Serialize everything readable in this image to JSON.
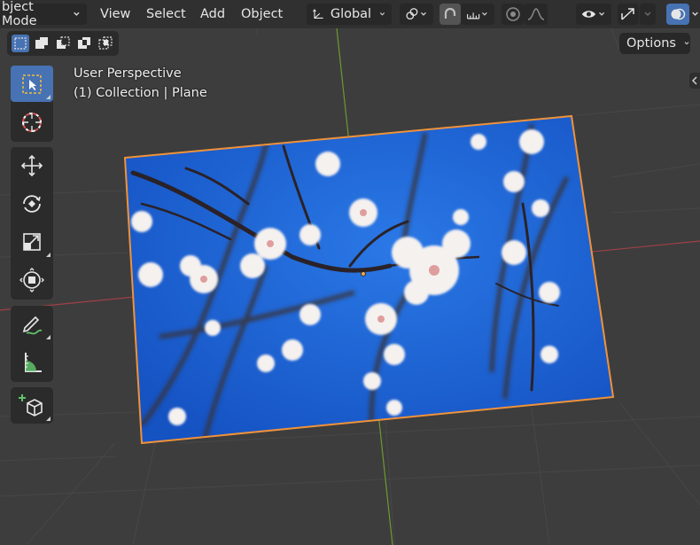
{
  "header": {
    "mode_label": "bject Mode",
    "menus": [
      "View",
      "Select",
      "Add",
      "Object"
    ],
    "orientation_label": "Global"
  },
  "options_label": "Options",
  "viewport": {
    "view_name": "User Perspective",
    "collection": "(1) Collection",
    "separator": "|",
    "active_object": "Plane"
  },
  "colors": {
    "background": "#3d3d3d",
    "header": "#303030",
    "active_tool": "#4772b3",
    "selection_outline": "#f0923a",
    "x_axis": "#a04047",
    "y_axis": "#6c9a2f",
    "sky": "#1a5fd0"
  },
  "tools": [
    {
      "icon": "select-box-icon"
    },
    {
      "icon": "cursor-icon"
    },
    {
      "icon": "move-icon"
    },
    {
      "icon": "rotate-icon"
    },
    {
      "icon": "scale-icon"
    },
    {
      "icon": "transform-icon"
    },
    {
      "icon": "annotate-icon"
    },
    {
      "icon": "measure-icon"
    },
    {
      "icon": "add-cube-icon"
    }
  ]
}
